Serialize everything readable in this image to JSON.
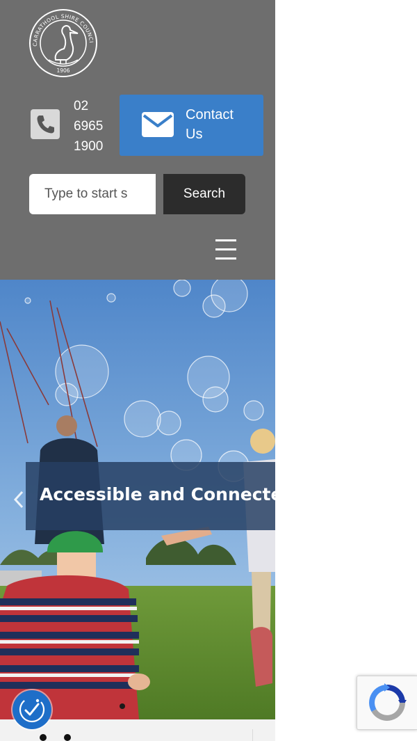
{
  "header": {
    "logo": {
      "icon": "council-seal-pelican-logo",
      "text_arc_top": "CARRATHOOL SHIRE COUNCIL",
      "year": "1906"
    },
    "phone": {
      "icon": "phone-icon",
      "line1": "02",
      "line2": "6965",
      "line3": "1900"
    },
    "contact": {
      "icon": "mail-icon",
      "label_line1": "Contact",
      "label_line2": "Us"
    },
    "social": {
      "icon": "facebook-icon"
    },
    "search": {
      "placeholder": "Type to start s",
      "button_label": "Search"
    },
    "menu": {
      "icon": "hamburger-menu-icon"
    }
  },
  "hero": {
    "caption": "Accessible and Connected",
    "prev_icon": "chevron-left-icon",
    "active_slide": 1
  },
  "widgets": {
    "accessibility_icon": "accessibility-icon",
    "recaptcha_icon": "recaptcha-icon"
  },
  "colors": {
    "header_bg": "#6e6e6e",
    "contact_button": "#3a7fc9",
    "search_button": "#2c2c2c",
    "caption_bg": "#263f63",
    "accessibility_button": "#1e6ec8"
  }
}
